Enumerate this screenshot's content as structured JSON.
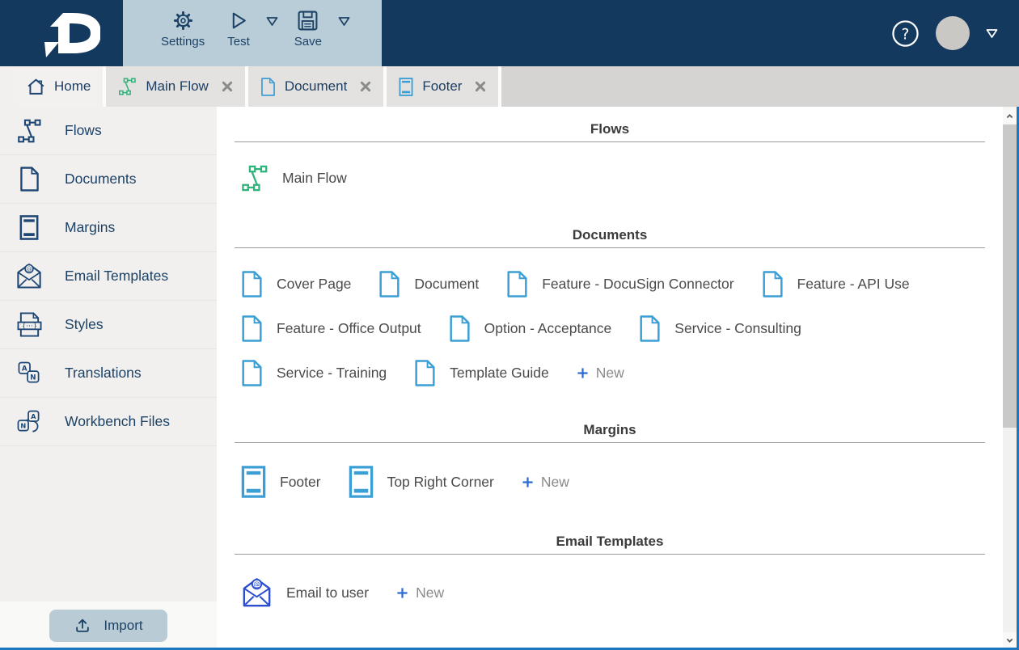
{
  "topbar": {
    "logo_letter": "D",
    "buttons": [
      {
        "name": "settings",
        "label": "Settings",
        "icon": "gear",
        "dropdown": false
      },
      {
        "name": "test",
        "label": "Test",
        "icon": "play",
        "dropdown": true
      },
      {
        "name": "save",
        "label": "Save",
        "icon": "floppy",
        "dropdown": true
      }
    ],
    "help_label": "?"
  },
  "tabs": [
    {
      "label": "Home",
      "icon": "home",
      "icon_color": "navy",
      "closable": false,
      "active": true
    },
    {
      "label": "Main Flow",
      "icon": "flow",
      "icon_color": "green",
      "closable": true,
      "active": false
    },
    {
      "label": "Document",
      "icon": "document",
      "icon_color": "blue",
      "closable": true,
      "active": false
    },
    {
      "label": "Footer",
      "icon": "margin",
      "icon_color": "blue",
      "closable": true,
      "active": false
    }
  ],
  "sidebar": {
    "items": [
      {
        "label": "Flows",
        "icon": "flow"
      },
      {
        "label": "Documents",
        "icon": "document"
      },
      {
        "label": "Margins",
        "icon": "margin"
      },
      {
        "label": "Email Templates",
        "icon": "envelope"
      },
      {
        "label": "Styles",
        "icon": "styles"
      },
      {
        "label": "Translations",
        "icon": "translations"
      },
      {
        "label": "Workbench Files",
        "icon": "workbench"
      }
    ],
    "import_label": "Import"
  },
  "main": {
    "sections": [
      {
        "title": "Flows",
        "icon": "flow",
        "icon_color": "green",
        "items": [
          "Main Flow"
        ],
        "new_label": null
      },
      {
        "title": "Documents",
        "icon": "document",
        "icon_color": "blue",
        "items": [
          "Cover Page",
          "Document",
          "Feature - DocuSign Connector",
          "Feature - API Use",
          "Feature - Office Output",
          "Option - Acceptance",
          "Service - Consulting",
          "Service - Training",
          "Template Guide"
        ],
        "new_label": "New"
      },
      {
        "title": "Margins",
        "icon": "margin",
        "icon_color": "blue",
        "items": [
          "Footer",
          "Top Right Corner"
        ],
        "new_label": "New"
      },
      {
        "title": "Email Templates",
        "icon": "envelope",
        "icon_color": "royal",
        "items": [
          "Email to user"
        ],
        "new_label": "New"
      }
    ]
  },
  "colors": {
    "header_navy": "#14395f",
    "toolbar_steel": "#b9cdd8",
    "flow_green": "#2eb47a",
    "document_blue": "#3b9fd6",
    "email_royal_blue": "#2b4ed0",
    "new_link_blue": "#2e6bd0",
    "accent_line_blue": "#1b76bd",
    "sidebar_gray": "#f1f0ee",
    "tab_gray": "#e3e2e0"
  }
}
